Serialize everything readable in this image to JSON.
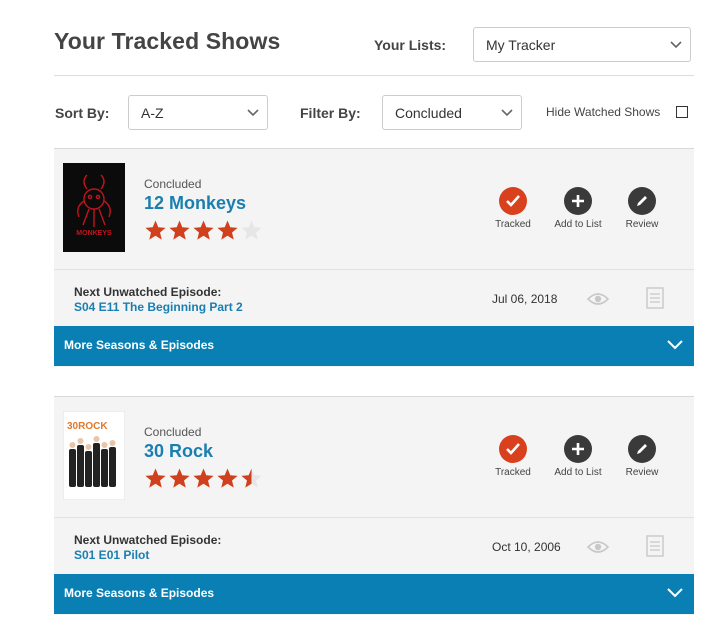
{
  "header": {
    "title": "Your Tracked Shows",
    "lists_label": "Your Lists:",
    "lists_value": "My Tracker"
  },
  "controls": {
    "sort_label": "Sort By:",
    "sort_value": "A-Z",
    "filter_label": "Filter By:",
    "filter_value": "Concluded",
    "hide_watched_label": "Hide Watched Shows",
    "hide_watched_checked": false
  },
  "shows": [
    {
      "status": "Concluded",
      "title": "12 Monkeys",
      "rating": 4,
      "actions": {
        "tracked": "Tracked",
        "add_to_list": "Add to List",
        "review": "Review"
      },
      "next_label": "Next Unwatched Episode:",
      "next_episode": "S04 E11 The Beginning Part 2",
      "next_date": "Jul 06, 2018",
      "more_label": "More Seasons & Episodes"
    },
    {
      "status": "Concluded",
      "title": "30 Rock",
      "rating": 4.5,
      "poster_text": "30ROCK",
      "actions": {
        "tracked": "Tracked",
        "add_to_list": "Add to List",
        "review": "Review"
      },
      "next_label": "Next Unwatched Episode:",
      "next_episode": "S01 E01 Pilot",
      "next_date": "Oct 10, 2006",
      "more_label": "More Seasons & Episodes"
    }
  ],
  "colors": {
    "accent_blue": "#0a7fb4",
    "title_blue": "#1a7fb0",
    "tracked_orange": "#d9411e",
    "star_orange": "#d0401c"
  }
}
